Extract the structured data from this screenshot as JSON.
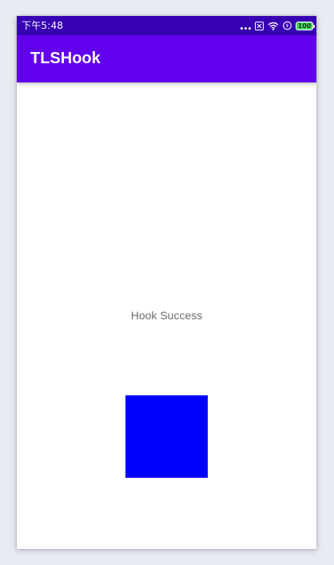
{
  "status_bar": {
    "time": "下午5:48",
    "battery": "100",
    "icons": [
      "more-dots-icon",
      "sim-card-icon",
      "wifi-icon",
      "charging-icon",
      "battery-icon"
    ]
  },
  "app_bar": {
    "title": "TLSHook"
  },
  "main": {
    "message": "Hook Success",
    "square_color": "#0000ff"
  },
  "colors": {
    "status_bar": "#3700b3",
    "app_bar": "#6200ee",
    "background": "#ffffff",
    "text": "#6b6b6b"
  }
}
